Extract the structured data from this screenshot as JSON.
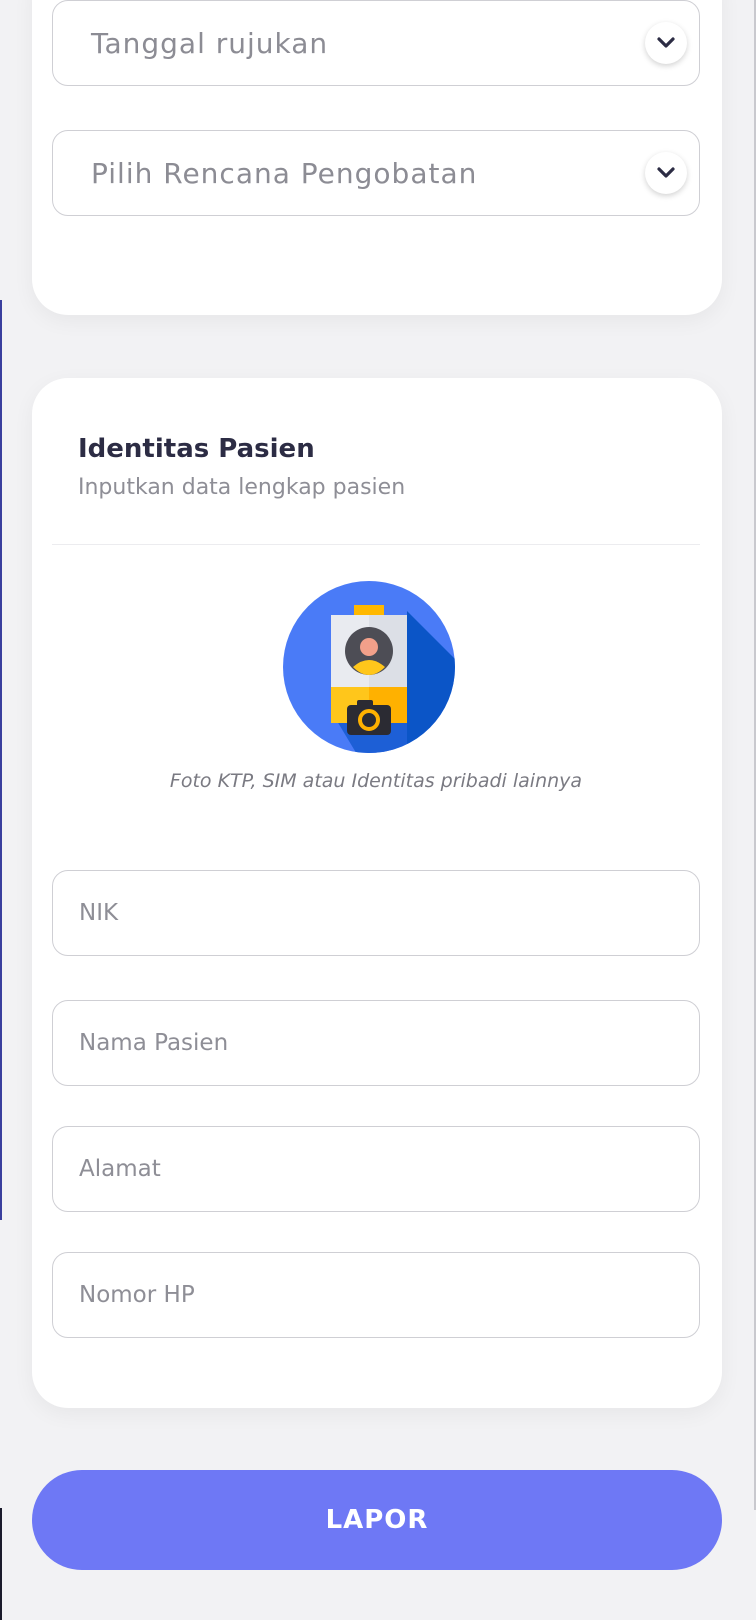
{
  "referral": {
    "date_placeholder": "Tanggal rujukan",
    "treatment_placeholder": "Pilih Rencana Pengobatan"
  },
  "identity": {
    "title": "Identitas Pasien",
    "subtitle": "Inputkan data lengkap pasien",
    "photo_caption": "Foto KTP, SIM  atau Identitas pribadi lainnya",
    "fields": {
      "nik_placeholder": "NIK",
      "name_placeholder": "Nama Pasien",
      "address_placeholder": "Alamat",
      "phone_placeholder": "Nomor HP"
    }
  },
  "submit_label": "LAPOR",
  "colors": {
    "accent": "#6e78f5",
    "background": "#f2f2f4",
    "card": "#ffffff",
    "heading": "#2c2c44",
    "muted_text": "#8e8e96",
    "photo_circle": "#4a7bf7",
    "photo_shadow": "#0b55c7",
    "photo_yellow": "#ffb800"
  },
  "icons": {
    "dropdown": "chevron-down-icon",
    "photo_upload": "id-card-camera-icon"
  }
}
